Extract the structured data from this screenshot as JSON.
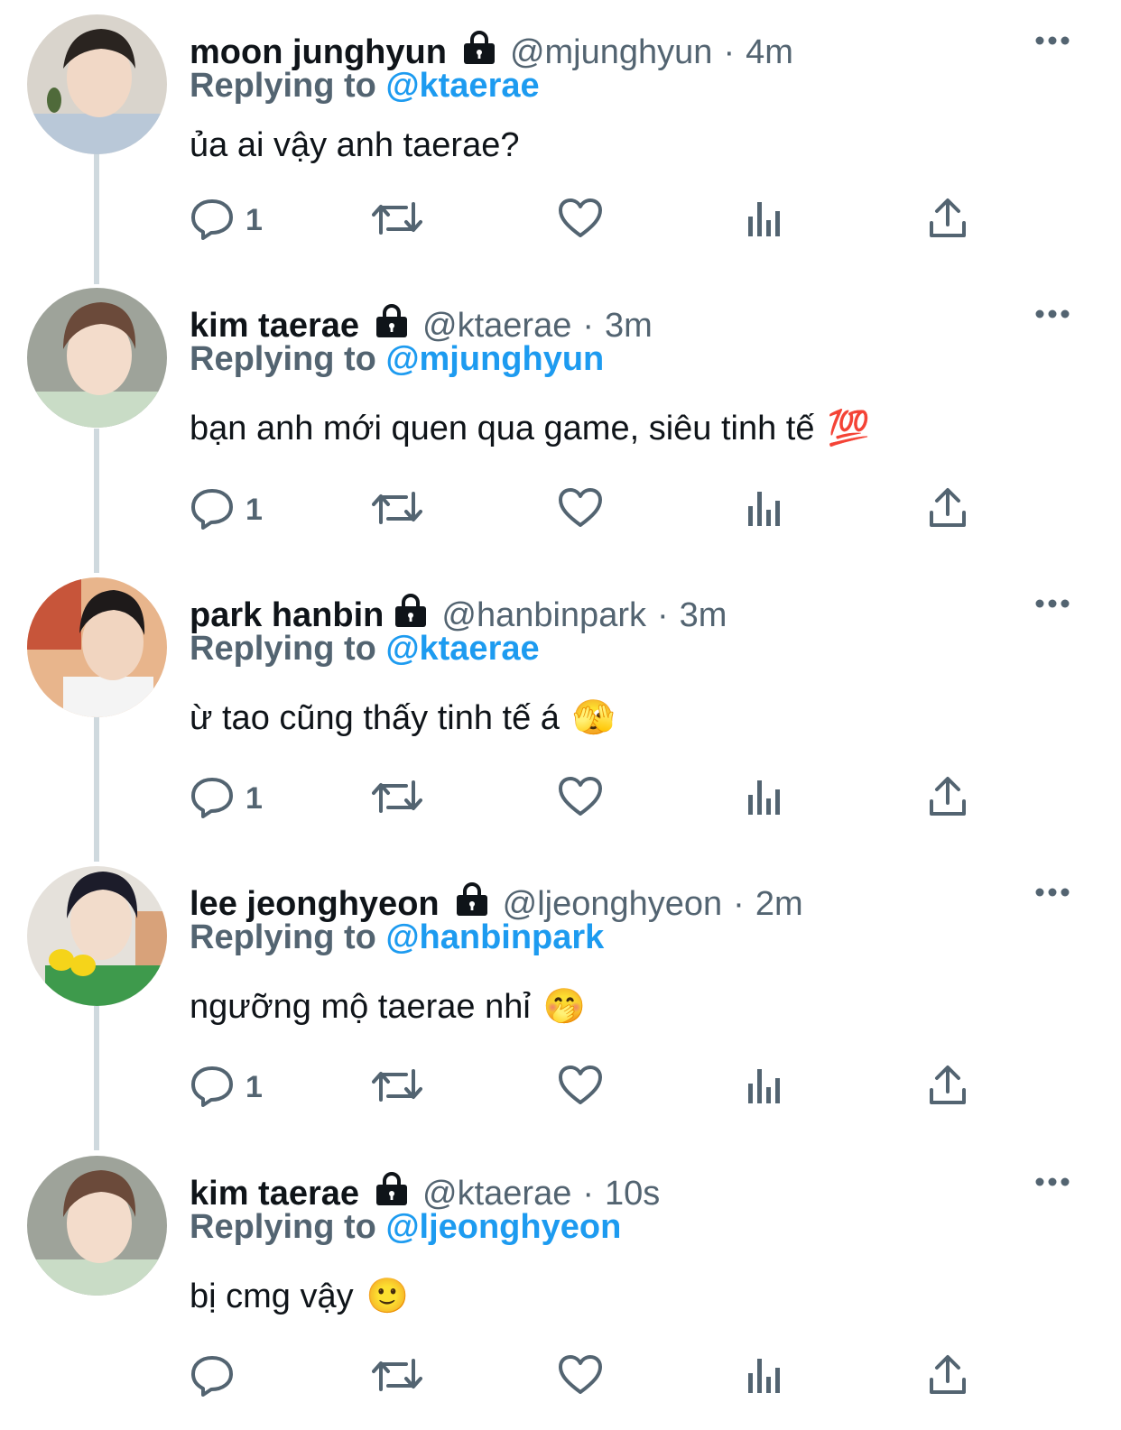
{
  "tweets": [
    {
      "name": "moon junghyun",
      "handle": "@mjunghyun",
      "time": "4m",
      "reply_prefix": "Replying to",
      "reply_to": "@ktaerae",
      "text": "ủa ai vậy anh taerae?",
      "emoji": "",
      "reply_count": "1"
    },
    {
      "name": "kim taerae",
      "handle": "@ktaerae",
      "time": "3m",
      "reply_prefix": "Replying to",
      "reply_to": "@mjunghyun",
      "text": "bạn anh mới quen qua game, siêu tinh tế",
      "emoji": "💯",
      "reply_count": "1"
    },
    {
      "name": "park hanbin",
      "handle": "@hanbinpark",
      "time": "3m",
      "reply_prefix": "Replying to",
      "reply_to": "@ktaerae",
      "text": "ừ tao cũng thấy tinh tế á",
      "emoji": "🫣",
      "reply_count": "1"
    },
    {
      "name": "lee jeonghyeon",
      "handle": "@ljeonghyeon",
      "time": "2m",
      "reply_prefix": "Replying to",
      "reply_to": "@hanbinpark",
      "text": "ngưỡng mộ taerae nhỉ",
      "emoji": "🤭",
      "reply_count": "1"
    },
    {
      "name": "kim taerae",
      "handle": "@ktaerae",
      "time": "10s",
      "reply_prefix": "Replying to",
      "reply_to": "@ljeonghyeon",
      "text": "bị cmg vậy",
      "emoji": "🙂",
      "reply_count": ""
    }
  ],
  "separator": "·",
  "icons": {
    "lock": "lock-icon",
    "more": "more-dots-icon",
    "reply": "reply-bubble-icon",
    "retweet": "retweet-icon",
    "like": "heart-icon",
    "views": "views-chart-icon",
    "share": "share-icon"
  },
  "colors": {
    "text": "#0f1419",
    "secondary": "#536471",
    "accent": "#1d9bf0",
    "thread_line": "#cfd9de"
  }
}
